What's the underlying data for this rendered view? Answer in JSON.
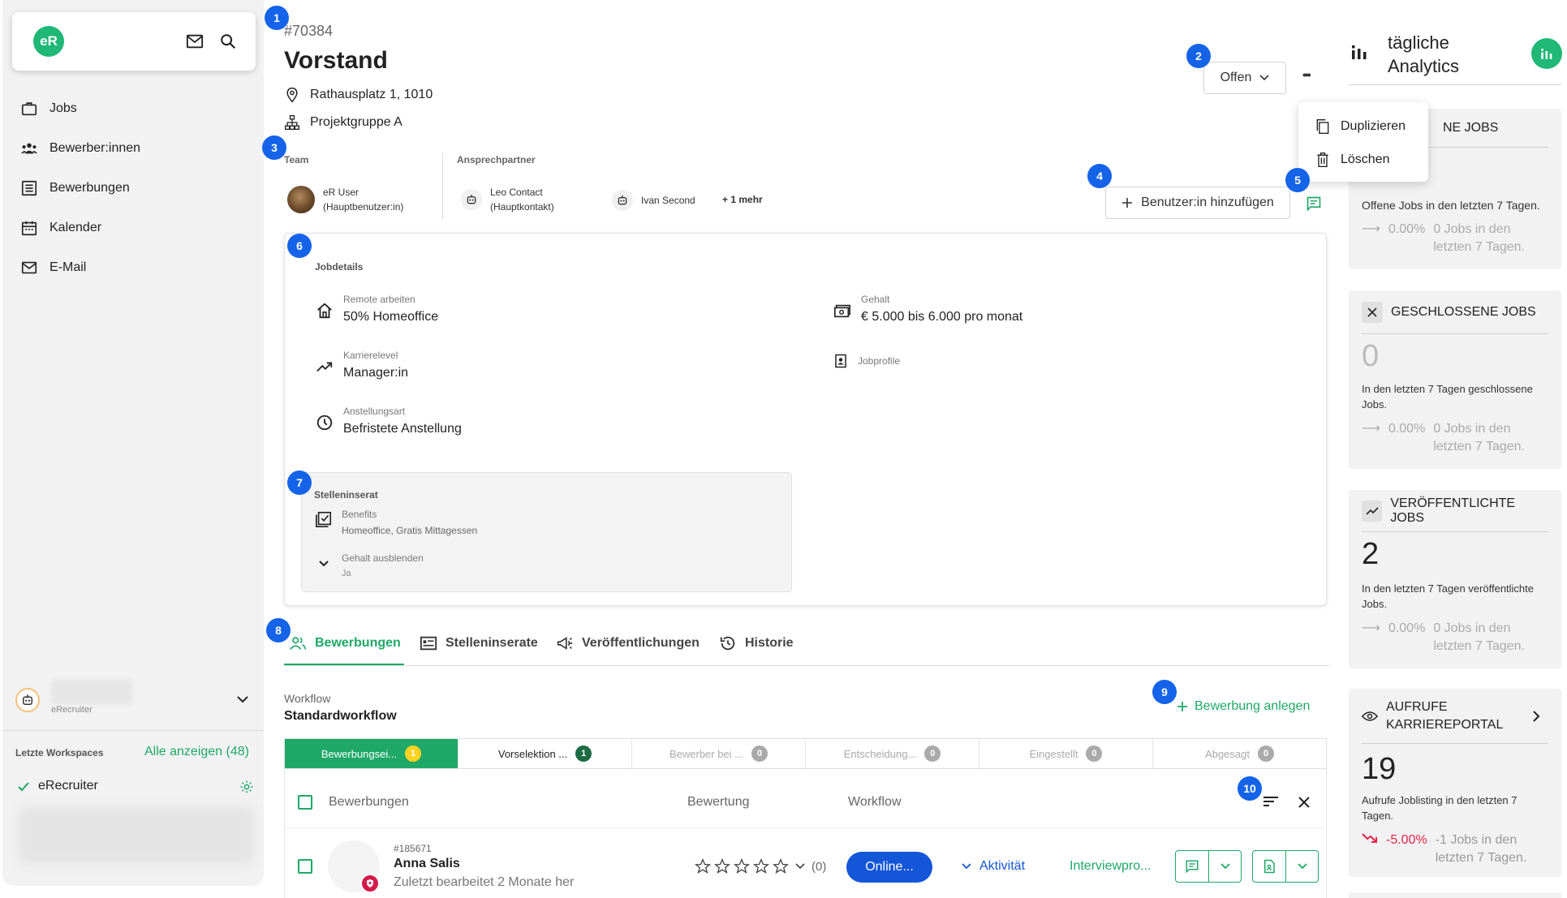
{
  "sidebar": {
    "brand_logo": "eR",
    "nav": [
      {
        "label": "Jobs",
        "icon": "briefcase-icon"
      },
      {
        "label": "Bewerber:innen",
        "icon": "people-icon"
      },
      {
        "label": "Bewerbungen",
        "icon": "list-icon"
      },
      {
        "label": "Kalender",
        "icon": "calendar-icon"
      },
      {
        "label": "E-Mail",
        "icon": "mail-icon"
      }
    ],
    "account_sub": "eRecruiter",
    "workspaces_label": "Letzte Workspaces",
    "show_all": "Alle anzeigen (48)",
    "workspace_name": "eRecruiter"
  },
  "markers": [
    "1",
    "2",
    "3",
    "4",
    "5",
    "6",
    "7",
    "8",
    "9",
    "10"
  ],
  "job": {
    "id": "#70384",
    "title": "Vorstand",
    "address": "Rathausplatz 1, 1010",
    "group": "Projektgruppe A",
    "status": "Offen",
    "more_icon": "•••"
  },
  "menu": {
    "duplicate": "Duplizieren",
    "delete": "Löschen"
  },
  "team": {
    "team_label": "Team",
    "contact_label": "Ansprechpartner",
    "user_name": "eR User",
    "user_role": "(Hauptbenutzer:in)",
    "contact_name": "Leo Contact",
    "contact_role": "(Hauptkontakt)",
    "contact2": "Ivan Second",
    "more": "+ 1 mehr",
    "add_user": "Benutzer:in hinzufügen"
  },
  "details": {
    "title": "Jobdetails",
    "remote_label": "Remote arbeiten",
    "remote_value": "50% Homeoffice",
    "salary_label": "Gehalt",
    "salary_value": "€ 5.000 bis 6.000 pro monat",
    "career_label": "Karrierelevel",
    "career_value": "Manager:in",
    "jobprofile_label": "Jobprofile",
    "employment_label": "Anstellungsart",
    "employment_value": "Befristete Anstellung",
    "ad_title": "Stelleninserat",
    "benefits_label": "Benefits",
    "benefits_value": "Homeoffice, Gratis Mittagessen",
    "hide_salary_label": "Gehalt ausblenden",
    "hide_salary_value": "Ja"
  },
  "tabs": [
    {
      "label": "Bewerbungen",
      "active": true
    },
    {
      "label": "Stelleninserate"
    },
    {
      "label": "Veröffentlichungen"
    },
    {
      "label": "Historie"
    }
  ],
  "workflow": {
    "label": "Workflow",
    "name": "Standardworkflow",
    "create_btn": "Bewerbung anlegen",
    "stages": [
      {
        "label": "Bewerbungsei...",
        "count": "1"
      },
      {
        "label": "Vorselektion ...",
        "count": "1"
      },
      {
        "label": "Bewerber bei ...",
        "count": "0"
      },
      {
        "label": "Entscheidung...",
        "count": "0"
      },
      {
        "label": "Eingestellt",
        "count": "0"
      },
      {
        "label": "Abgesagt",
        "count": "0"
      }
    ]
  },
  "list": {
    "col_apps": "Bewerbungen",
    "col_rating": "Bewertung",
    "col_workflow": "Workflow",
    "row": {
      "id": "#185671",
      "name": "Anna Salis",
      "edited": "Zuletzt bearbeitet 2 Monate her",
      "rating_count": "(0)",
      "status_btn": "Online...",
      "activity": "Aktivität",
      "interview": "Interviewpro..."
    }
  },
  "analytics": {
    "title_line1": "tägliche",
    "title_line2": "Analytics",
    "open": {
      "head": "NE JOBS",
      "desc": "Offene Jobs in den letzten 7 Tagen.",
      "pct": "0.00%",
      "change": "0 Jobs in den letzten 7 Tagen."
    },
    "closed": {
      "head": "GESCHLOSSENE JOBS",
      "value": "0",
      "desc": "In den letzten 7 Tagen geschlossene Jobs.",
      "pct": "0.00%",
      "change": "0 Jobs in den letzten 7 Tagen."
    },
    "published": {
      "head": "VERÖFFENTLICHTE JOBS",
      "value": "2",
      "desc": "In den letzten 7 Tagen veröffentlichte Jobs.",
      "pct": "0.00%",
      "change": "0 Jobs in den letzten 7 Tagen."
    },
    "views": {
      "head": "AUFRUFE KARRIEREPORTAL",
      "value": "19",
      "desc": "Aufrufe Joblisting in den letzten 7 Tagen.",
      "pct": "-5.00%",
      "change": "-1 Jobs in den letzten 7 Tagen."
    }
  },
  "colors": {
    "accent_green": "#1fa868",
    "brand_green": "#1fb876",
    "marker_blue": "#1463e8",
    "primary_blue": "#1456d8",
    "negative_red": "#e0244a",
    "stage_active": "#1fa868",
    "pill_yellow": "#ffd21f"
  }
}
